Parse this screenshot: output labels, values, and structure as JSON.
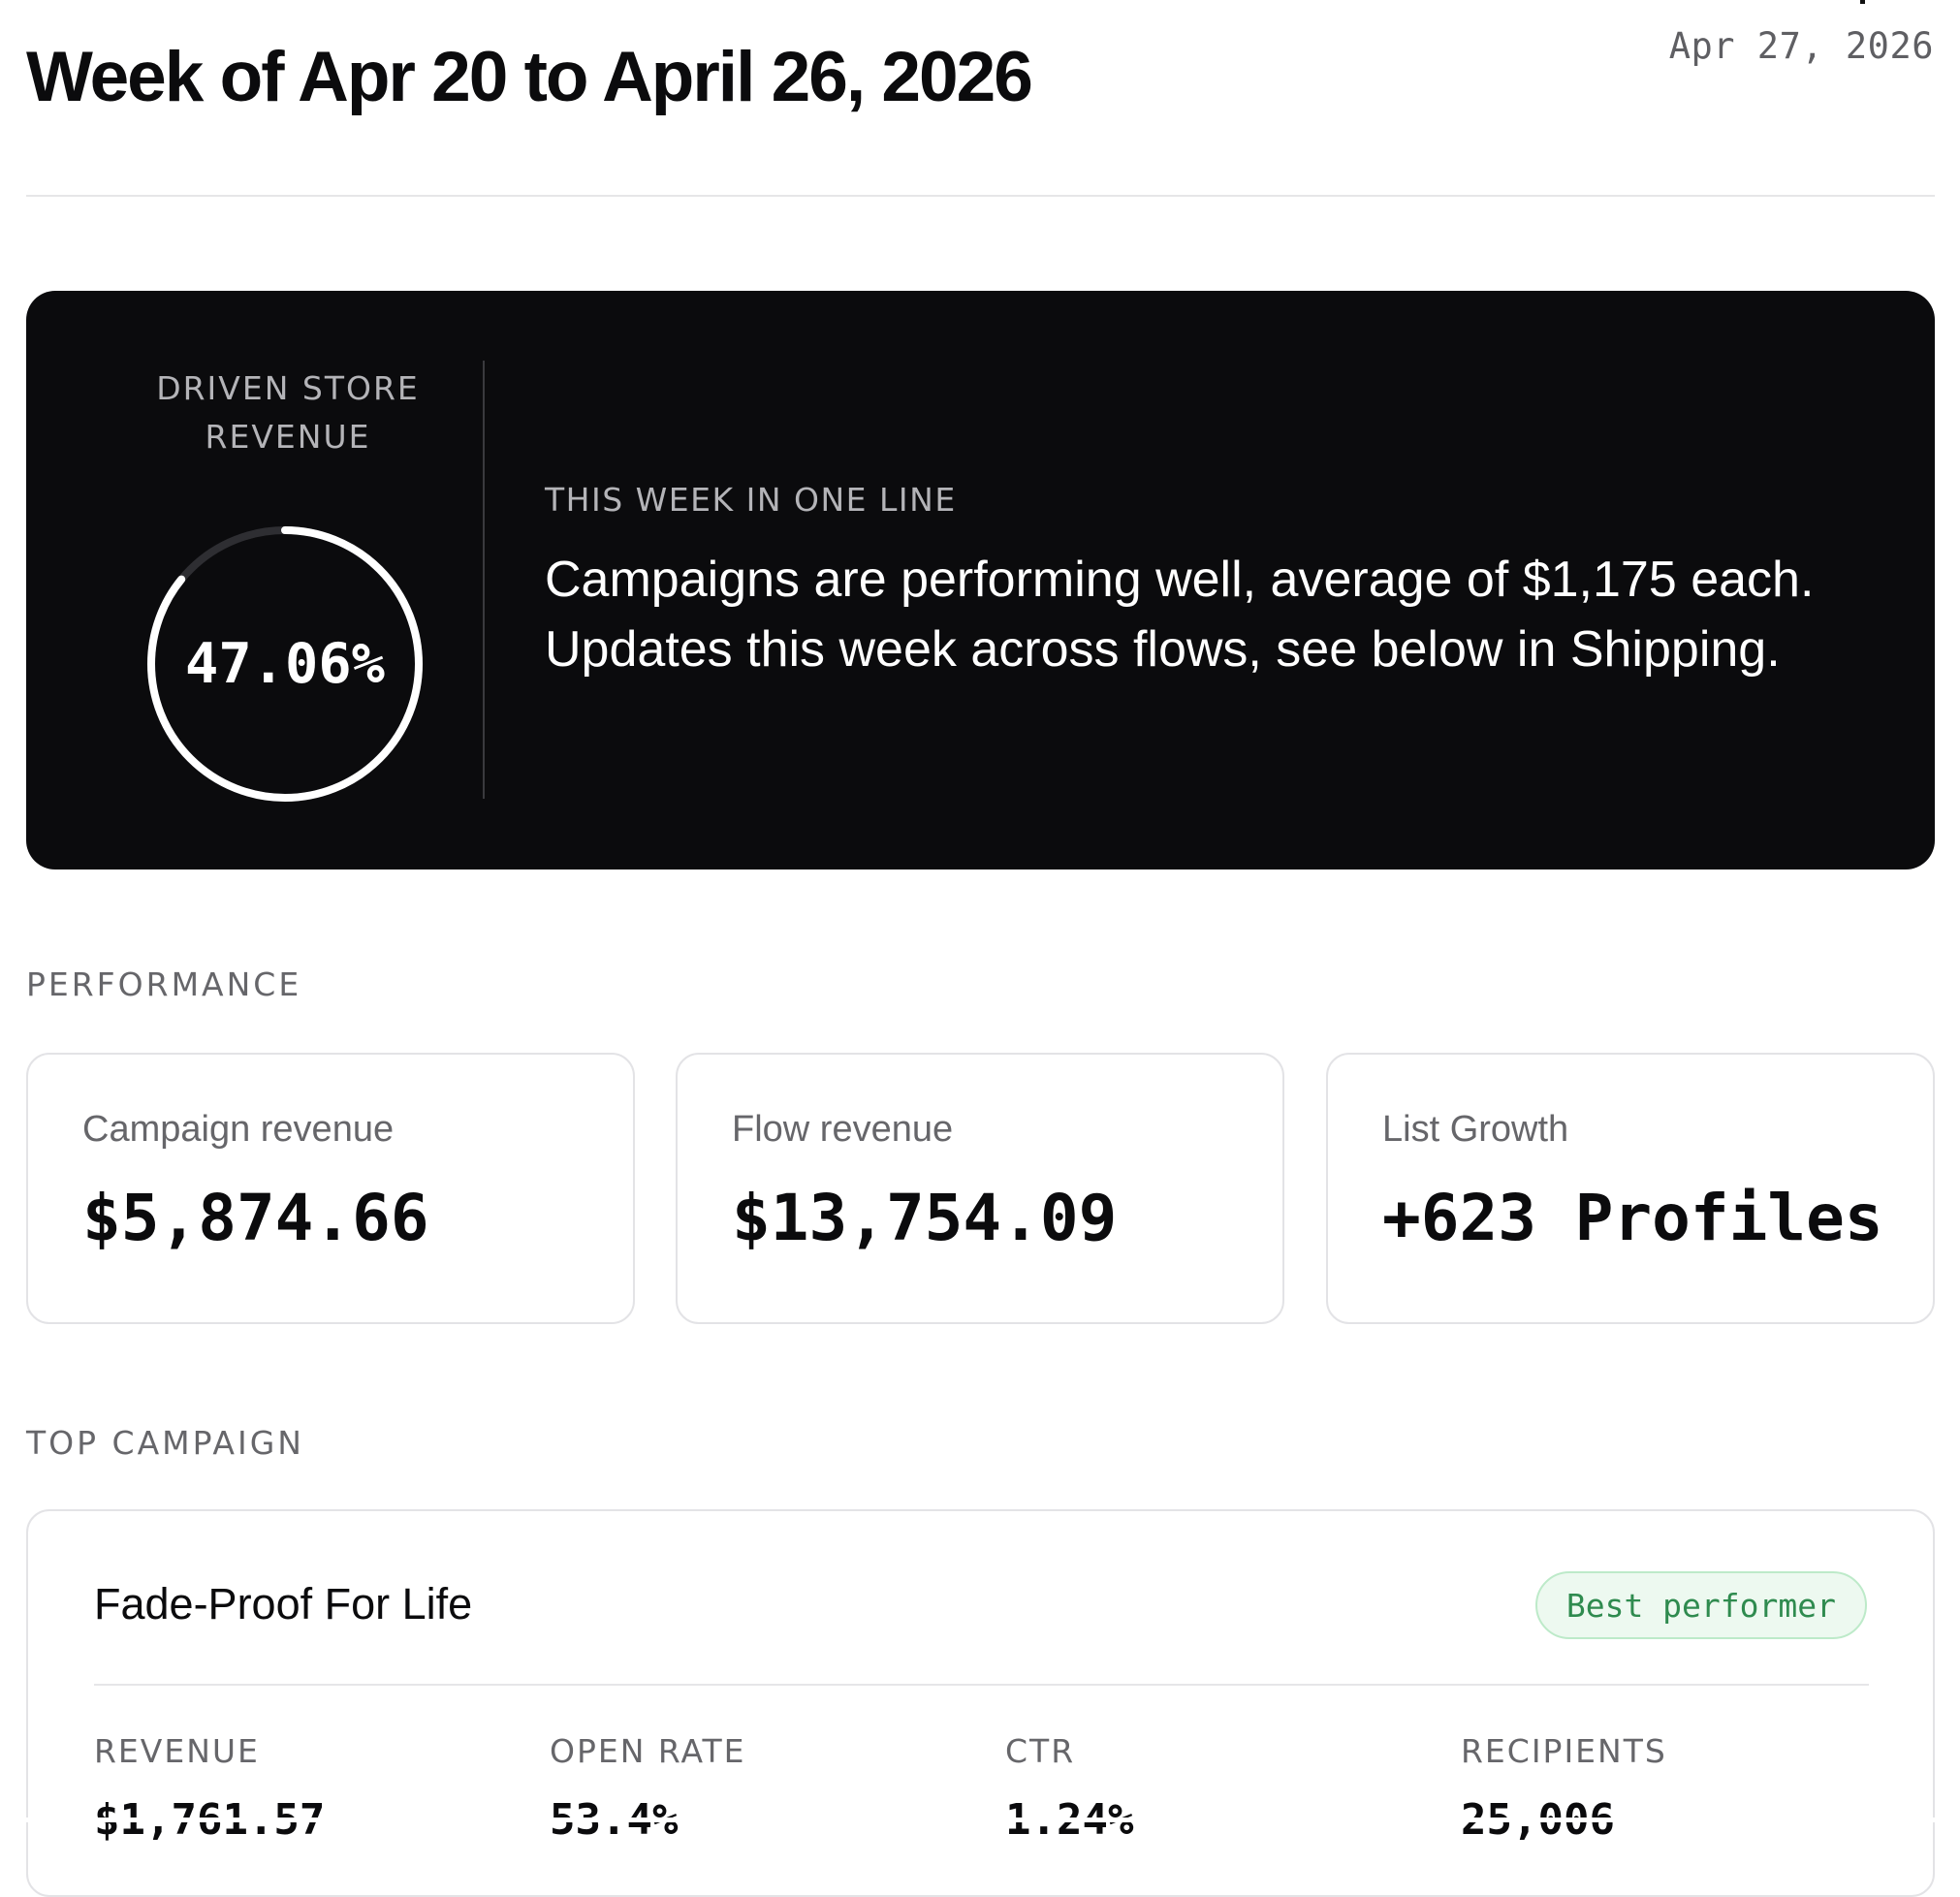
{
  "header": {
    "title": "Week of Apr 20 to April 26, 2026",
    "date": "Apr 27, 2026"
  },
  "hero": {
    "metric_label_line1": "DRIVEN STORE",
    "metric_label_line2": "REVENUE",
    "percent_text": "47.06%",
    "percent_value": 47.06,
    "summary_label": "THIS WEEK IN ONE LINE",
    "summary_line1": "Campaigns are performing well, average of $1,175 each.",
    "summary_line2": "Updates this week across flows, see below in Shipping."
  },
  "performance": {
    "section_label": "PERFORMANCE",
    "cards": [
      {
        "label": "Campaign revenue",
        "value": "$5,874.66"
      },
      {
        "label": "Flow revenue",
        "value": "$13,754.09"
      },
      {
        "label": "List Growth",
        "value": "+623 Profiles"
      }
    ]
  },
  "top_campaign": {
    "section_label": "TOP CAMPAIGN",
    "name": "Fade-Proof For Life",
    "badge": "Best performer",
    "stats": [
      {
        "label": "REVENUE",
        "value": "$1,761.57"
      },
      {
        "label": "OPEN RATE",
        "value": "53.4%"
      },
      {
        "label": "CTR",
        "value": "1.24%"
      },
      {
        "label": "RECIPIENTS",
        "value": "25,006"
      }
    ]
  },
  "colors": {
    "hero_bg": "#0b0b0d",
    "gauge_fill": "#ffffff",
    "gauge_track": "#2e2e32",
    "badge_text": "#2f8b4f",
    "badge_bg": "#edf9f0"
  }
}
